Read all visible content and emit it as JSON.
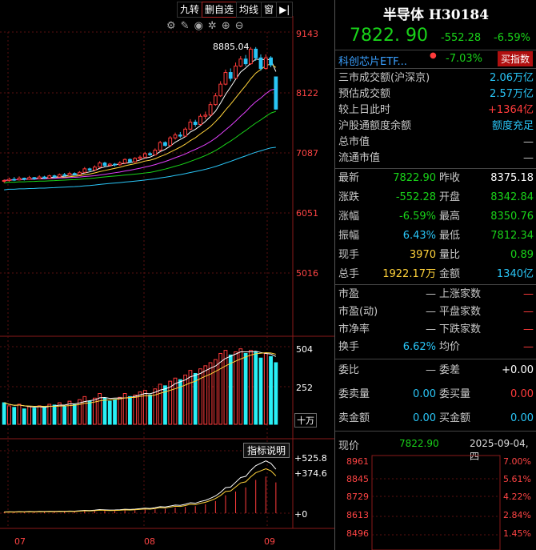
{
  "toolbar": {
    "items": [
      "九转",
      "删自选",
      "均线",
      "窗"
    ],
    "play_icon": "play-arrow-icon"
  },
  "chart": {
    "peak_label": "8885.04",
    "price_ticks": [
      "9143",
      "8122",
      "7087",
      "6051",
      "5016"
    ],
    "volume_ticks": [
      "504",
      "252"
    ],
    "volume_unit": "十万",
    "indicator_ticks": [
      "+525.8",
      "+374.6",
      "+0"
    ],
    "indicator_button": "指标说明",
    "x_months": [
      "07",
      "08",
      "09"
    ],
    "tool_icons": [
      "settings-icon",
      "pen-icon",
      "eye-icon",
      "gear-icon",
      "plus-icon",
      "minus-icon"
    ]
  },
  "chart_data": {
    "type": "candlestick",
    "y_range": [
      5016,
      9143
    ],
    "candles": [
      [
        6590,
        6600,
        6560,
        6620
      ],
      [
        6600,
        6620,
        6580,
        6650
      ],
      [
        6620,
        6610,
        6590,
        6660
      ],
      [
        6610,
        6640,
        6600,
        6670
      ],
      [
        6640,
        6620,
        6600,
        6650
      ],
      [
        6620,
        6650,
        6610,
        6680
      ],
      [
        6650,
        6630,
        6610,
        6660
      ],
      [
        6630,
        6660,
        6620,
        6690
      ],
      [
        6660,
        6640,
        6620,
        6680
      ],
      [
        6640,
        6680,
        6630,
        6700
      ],
      [
        6680,
        6660,
        6640,
        6700
      ],
      [
        6660,
        6700,
        6650,
        6720
      ],
      [
        6700,
        6690,
        6670,
        6730
      ],
      [
        6690,
        6720,
        6680,
        6750
      ],
      [
        6720,
        6700,
        6690,
        6740
      ],
      [
        6700,
        6740,
        6690,
        6760
      ],
      [
        6740,
        6800,
        6730,
        6830
      ],
      [
        6800,
        6780,
        6760,
        6820
      ],
      [
        6780,
        6830,
        6770,
        6860
      ],
      [
        6830,
        6900,
        6810,
        6930
      ],
      [
        6900,
        6860,
        6840,
        6920
      ],
      [
        6860,
        6880,
        6840,
        6900
      ],
      [
        6880,
        6870,
        6840,
        6900
      ],
      [
        6870,
        6900,
        6850,
        6930
      ],
      [
        6900,
        6960,
        6880,
        6980
      ],
      [
        6960,
        6920,
        6900,
        6980
      ],
      [
        6920,
        6980,
        6900,
        7000
      ],
      [
        6980,
        7000,
        6950,
        7030
      ],
      [
        7000,
        7060,
        6980,
        7090
      ],
      [
        7060,
        7040,
        7020,
        7090
      ],
      [
        7040,
        7120,
        7030,
        7150
      ],
      [
        7120,
        7250,
        7100,
        7280
      ],
      [
        7250,
        7200,
        7180,
        7270
      ],
      [
        7200,
        7330,
        7190,
        7360
      ],
      [
        7330,
        7380,
        7300,
        7420
      ],
      [
        7380,
        7360,
        7330,
        7430
      ],
      [
        7360,
        7480,
        7350,
        7510
      ],
      [
        7480,
        7600,
        7460,
        7650
      ],
      [
        7600,
        7560,
        7520,
        7640
      ],
      [
        7560,
        7700,
        7550,
        7740
      ],
      [
        7700,
        7720,
        7650,
        7780
      ],
      [
        7720,
        7900,
        7700,
        7950
      ],
      [
        7900,
        8050,
        7880,
        8100
      ],
      [
        8050,
        8250,
        8030,
        8300
      ],
      [
        8250,
        8450,
        8230,
        8500
      ],
      [
        8450,
        8350,
        8300,
        8520
      ],
      [
        8350,
        8560,
        8340,
        8620
      ],
      [
        8560,
        8680,
        8540,
        8730
      ],
      [
        8680,
        8600,
        8560,
        8750
      ],
      [
        8600,
        8850,
        8580,
        8885
      ],
      [
        8850,
        8700,
        8650,
        8885
      ],
      [
        8700,
        8520,
        8480,
        8760
      ],
      [
        8520,
        8700,
        8500,
        8760
      ],
      [
        8700,
        8580,
        8540,
        8730
      ],
      [
        8375,
        7823,
        7812,
        8351
      ]
    ],
    "volumes": [
      140,
      120,
      110,
      130,
      100,
      115,
      105,
      120,
      110,
      130,
      125,
      140,
      118,
      150,
      128,
      160,
      180,
      150,
      170,
      200,
      170,
      150,
      160,
      175,
      200,
      180,
      190,
      210,
      220,
      190,
      230,
      260,
      250,
      280,
      300,
      290,
      320,
      350,
      330,
      360,
      380,
      400,
      420,
      460,
      480,
      450,
      470,
      490,
      460,
      480,
      470,
      430,
      460,
      440,
      400
    ],
    "volume_color": [
      "c",
      "r",
      "c",
      "r",
      "c",
      "r",
      "c",
      "r",
      "c",
      "r",
      "c",
      "r",
      "c",
      "r",
      "c",
      "r",
      "r",
      "c",
      "r",
      "r",
      "c",
      "c",
      "c",
      "r",
      "r",
      "c",
      "r",
      "r",
      "r",
      "c",
      "r",
      "r",
      "c",
      "r",
      "r",
      "c",
      "r",
      "r",
      "c",
      "r",
      "r",
      "r",
      "r",
      "r",
      "r",
      "c",
      "r",
      "r",
      "c",
      "r",
      "c",
      "c",
      "r",
      "c",
      "c"
    ],
    "indicator": [
      10,
      12,
      11,
      13,
      12,
      14,
      13,
      15,
      14,
      16,
      15,
      17,
      16,
      18,
      17,
      20,
      24,
      22,
      25,
      30,
      28,
      26,
      27,
      29,
      33,
      31,
      34,
      38,
      42,
      40,
      46,
      55,
      52,
      60,
      68,
      66,
      75,
      88,
      84,
      98,
      108,
      125,
      145,
      175,
      215,
      220,
      260,
      300,
      310,
      360,
      400,
      420,
      440,
      420,
      370
    ]
  },
  "header": {
    "name": "半导体",
    "code": "H30184",
    "price": "7822. 90",
    "change": "-552.28",
    "pct": "-6.59%"
  },
  "etf": {
    "name": "科创芯片ETF...",
    "pct": "-7.03%",
    "button": "买指数"
  },
  "turnover": [
    {
      "label": "三市成交额(沪深京)",
      "value": "2.06万亿",
      "color": "cyan"
    },
    {
      "label": "预估成交额",
      "value": "2.57万亿",
      "color": "cyan"
    },
    {
      "label": "较上日此时",
      "value": "+1364亿",
      "color": "red"
    },
    {
      "label": "沪股通额度余额",
      "value": "额度充足",
      "color": "cyan"
    },
    {
      "label": "总市值",
      "value": "—",
      "color": "gray"
    },
    {
      "label": "流通市值",
      "value": "—",
      "color": "gray"
    }
  ],
  "quote": [
    {
      "l1": "最新",
      "v1": "7822.90",
      "c1": "green",
      "l2": "昨收",
      "v2": "8375.18",
      "c2": "white"
    },
    {
      "l1": "涨跌",
      "v1": "-552.28",
      "c1": "green",
      "l2": "开盘",
      "v2": "8342.84",
      "c2": "green"
    },
    {
      "l1": "涨幅",
      "v1": "-6.59%",
      "c1": "green",
      "l2": "最高",
      "v2": "8350.76",
      "c2": "green"
    },
    {
      "l1": "振幅",
      "v1": "6.43%",
      "c1": "cyan",
      "l2": "最低",
      "v2": "7812.34",
      "c2": "green"
    },
    {
      "l1": "现手",
      "v1": "3970",
      "c1": "yellow",
      "l2": "量比",
      "v2": "0.89",
      "c2": "green"
    },
    {
      "l1": "总手",
      "v1": "1922.17万",
      "c1": "yellow",
      "l2": "金额",
      "v2": "1340亿",
      "c2": "cyan"
    }
  ],
  "stats": [
    {
      "l1": "市盈",
      "v1": "—",
      "l2": "上涨家数",
      "v2": "—"
    },
    {
      "l1": "市盈(动)",
      "v1": "—",
      "l2": "平盘家数",
      "v2": "—"
    },
    {
      "l1": "市净率",
      "v1": "—",
      "l2": "下跌家数",
      "v2": "—"
    },
    {
      "l1": "换手",
      "v1": "6.62%",
      "c1": "cyan",
      "l2": "均价",
      "v2": "—"
    }
  ],
  "orders": [
    {
      "l1": "委比",
      "v1": "—",
      "l2": "委差",
      "v2": "+0.00",
      "c2": "white"
    },
    {
      "l1": "委卖量",
      "v1": "0.00",
      "l2": "委买量",
      "v2": "0.00",
      "c2": "red"
    },
    {
      "l1": "卖金额",
      "v1": "0.00",
      "l2": "买金额",
      "v2": "0.00",
      "c2": "cyan"
    }
  ],
  "mini": {
    "label": "现价",
    "price": "7822.90",
    "date": "2025-09-04,四",
    "left_ticks": [
      "8961",
      "8845",
      "8729",
      "8613",
      "8496"
    ],
    "right_ticks": [
      "7.00%",
      "5.61%",
      "4.22%",
      "2.84%",
      "1.45%"
    ]
  }
}
